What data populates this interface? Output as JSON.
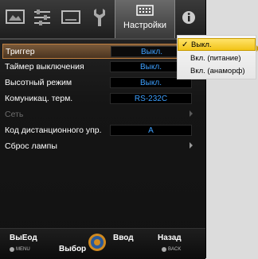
{
  "tabs": {
    "active_label": "Настройки"
  },
  "menu": {
    "items": [
      {
        "label": "Триггер",
        "value": "Выкл."
      },
      {
        "label": "Таймер выключения",
        "value": "Выкл."
      },
      {
        "label": "Высотный режим",
        "value": "Выкл."
      },
      {
        "label": "Комуникац. терм.",
        "value": "RS-232C"
      },
      {
        "label": "Сеть"
      },
      {
        "label": "Код дистанционного упр.",
        "value": "A"
      },
      {
        "label": "Сброс лампы"
      }
    ]
  },
  "dropdown": {
    "options": [
      "Выкл.",
      "Вкл. (питание)",
      "Вкл. (анаморф)"
    ],
    "selected": "Выкл."
  },
  "bottom": {
    "exit_label": "ВыЕод",
    "exit_hint": "MENU",
    "select_label": "Выбор",
    "enter_label": "Ввод",
    "back_label": "Назад",
    "back_hint": "BACK"
  },
  "colors": {
    "value_text": "#3da0ff",
    "selected_row": "#6a4a2a",
    "dropdown_highlight": "#f2c417"
  }
}
